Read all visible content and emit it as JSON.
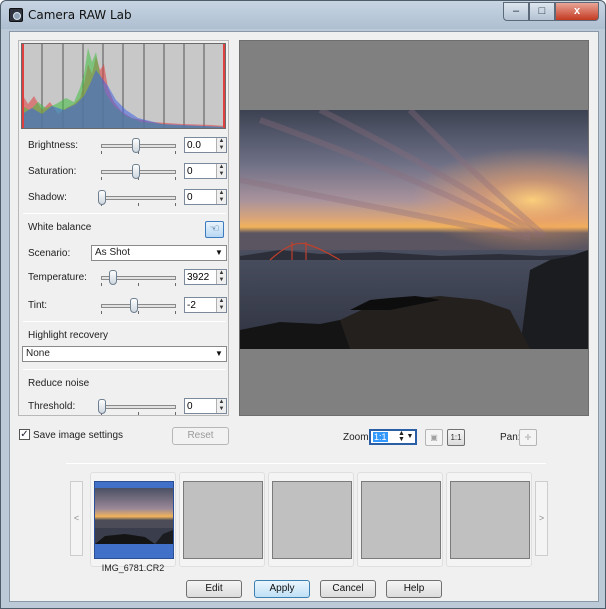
{
  "window": {
    "title": "Camera RAW Lab",
    "caption_buttons": {
      "minimize": "–",
      "maximize": "□",
      "close": "x"
    }
  },
  "adjustments": {
    "brightness": {
      "label": "Brightness:",
      "value": "0.0",
      "level": 0.5
    },
    "saturation": {
      "label": "Saturation:",
      "value": "0",
      "level": 0.5
    },
    "shadow": {
      "label": "Shadow:",
      "value": "0",
      "level": 0.0
    }
  },
  "white_balance": {
    "section_label": "White balance",
    "picker_icon": "eyedropper-hand-icon",
    "scenario_label": "Scenario:",
    "scenario_value": "As Shot",
    "temperature": {
      "label": "Temperature:",
      "value": "3922",
      "level": 0.17
    },
    "tint": {
      "label": "Tint:",
      "value": "-2",
      "level": 0.48
    }
  },
  "highlight_recovery": {
    "section_label": "Highlight recovery",
    "value": "None"
  },
  "noise": {
    "section_label": "Reduce noise",
    "threshold": {
      "label": "Threshold:",
      "value": "0",
      "level": 0.0
    }
  },
  "options": {
    "save_settings_label": "Save image settings",
    "save_settings_checked": "✓",
    "reset_label": "Reset"
  },
  "view": {
    "zoom_label": "Zoom:",
    "zoom_value": "1:1",
    "fit_icon": "fit-to-window-icon",
    "actual_size_icon": "actual-size-icon",
    "pan_label": "Pan:",
    "pan_icon": "pan-cross-icon"
  },
  "filmstrip": {
    "prev": "<",
    "next": ">",
    "items": [
      {
        "filename": "IMG_6781.CR2",
        "selected": true
      }
    ]
  },
  "buttons": {
    "edit": "Edit",
    "apply": "Apply",
    "cancel": "Cancel",
    "help": "Help"
  },
  "colors": {
    "preview_background": "#808080",
    "selection_blue": "#3399ff",
    "histogram_red": "#e04040",
    "histogram_green": "#40c040",
    "histogram_blue": "#4060e0"
  }
}
